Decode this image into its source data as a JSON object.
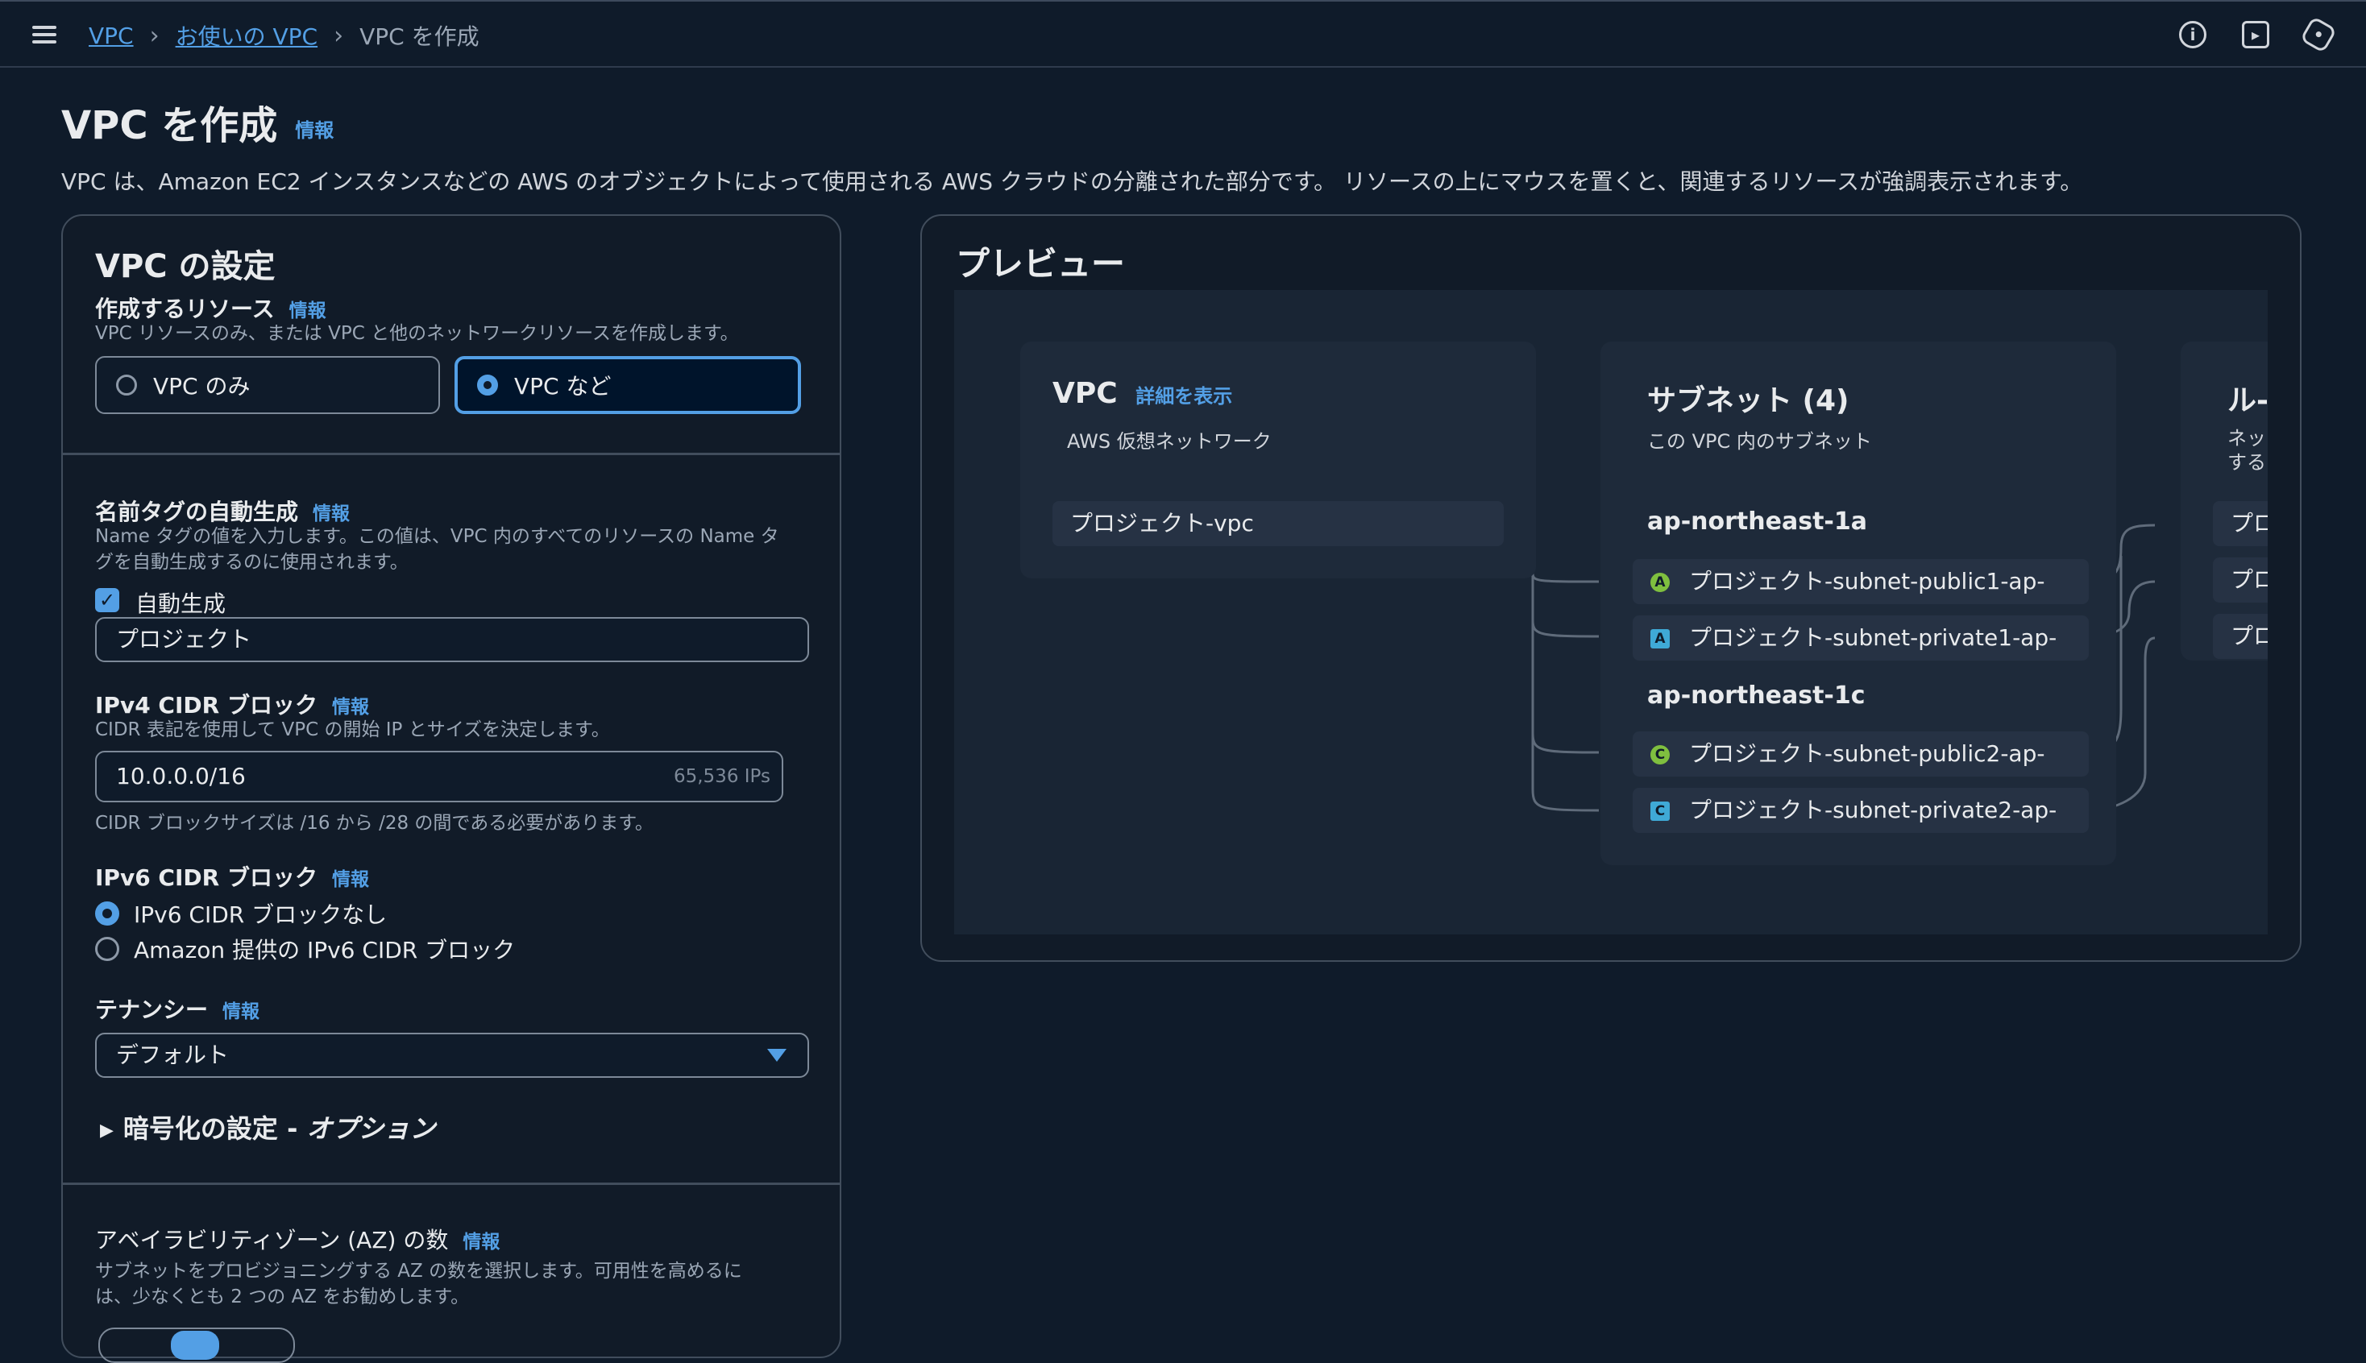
{
  "breadcrumb": {
    "items": [
      "VPC",
      "お使いの VPC"
    ],
    "current": "VPC を作成"
  },
  "header_icons": [
    "info-icon",
    "feedback-icon",
    "settings-icon"
  ],
  "page": {
    "title": "VPC を作成",
    "info": "情報",
    "description": "VPC は、Amazon EC2 インスタンスなどの AWS のオブジェクトによって使用される AWS クラウドの分離された部分です。 リソースの上にマウスを置くと、関連するリソースが強調表示されます。"
  },
  "settings": {
    "title": "VPC の設定",
    "resources": {
      "label": "作成するリソース",
      "info": "情報",
      "desc": "VPC リソースのみ、または VPC と他のネットワークリソースを作成します。",
      "options": [
        "VPC のみ",
        "VPC など"
      ],
      "selected": "VPC など"
    },
    "name_tag": {
      "label": "名前タグの自動生成",
      "info": "情報",
      "desc_line1": "Name タグの値を入力します。この値は、VPC 内のすべてのリソースの Name タ",
      "desc_line2": "グを自動生成するのに使用されます。",
      "checkbox_label": "自動生成",
      "checked": true,
      "value": "プロジェクト"
    },
    "ipv4": {
      "label": "IPv4 CIDR ブロック",
      "info": "情報",
      "desc": "CIDR 表記を使用して VPC の開始 IP とサイズを決定します。",
      "value": "10.0.0.0/16",
      "hint": "65,536 IPs",
      "constraint": "CIDR ブロックサイズは /16 から /28 の間である必要があります。"
    },
    "ipv6": {
      "label": "IPv6 CIDR ブロック",
      "info": "情報",
      "options": [
        "IPv6 CIDR ブロックなし",
        "Amazon 提供の IPv6 CIDR ブロック"
      ],
      "selected": "IPv6 CIDR ブロックなし"
    },
    "tenancy": {
      "label": "テナンシー",
      "info": "情報",
      "value": "デフォルト"
    },
    "encryption": {
      "label": "暗号化の設定 - ",
      "optional": "オプション"
    },
    "az": {
      "label": "アベイラビリティゾーン (AZ) の数",
      "info": "情報",
      "desc_line1": "サブネットをプロビジョニングする AZ の数を選択します。可用性を高めるに",
      "desc_line2": "は、少なくとも 2 つの AZ をお勧めします。"
    }
  },
  "preview": {
    "title": "プレビュー",
    "vpc": {
      "title": "VPC",
      "link": "詳細を表示",
      "sub": "AWS 仮想ネットワーク",
      "item": "プロジェクト-vpc"
    },
    "subnets": {
      "title": "サブネット (4)",
      "sub": "この VPC 内のサブネット",
      "zones": [
        {
          "name": "ap-northeast-1a",
          "items": [
            {
              "badge": "A",
              "type": "public",
              "label": "プロジェクト-subnet-public1-ap-"
            },
            {
              "badge": "A",
              "type": "private",
              "label": "プロジェクト-subnet-private1-ap-"
            }
          ]
        },
        {
          "name": "ap-northeast-1c",
          "items": [
            {
              "badge": "C",
              "type": "public",
              "label": "プロジェクト-subnet-public2-ap-"
            },
            {
              "badge": "C",
              "type": "private",
              "label": "プロジェクト-subnet-private2-ap-"
            }
          ]
        }
      ]
    },
    "routes": {
      "title": "ル-",
      "sub_line1": "ネッ",
      "sub_line2": "する",
      "items": [
        "プロ",
        "プロ",
        "プロ"
      ]
    }
  }
}
